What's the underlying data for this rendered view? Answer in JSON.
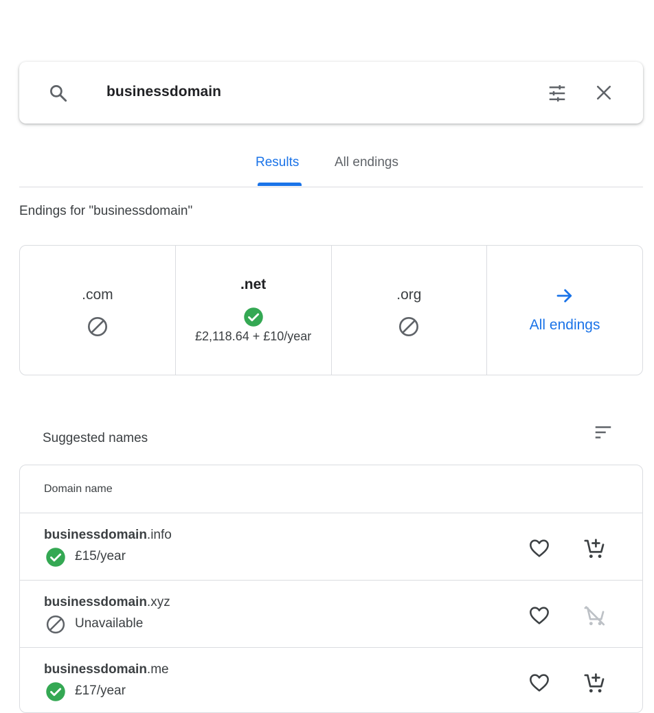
{
  "search": {
    "query": "businessdomain"
  },
  "tabs": [
    {
      "label": "Results",
      "active": true
    },
    {
      "label": "All endings",
      "active": false
    }
  ],
  "endings": {
    "heading": "Endings for \"businessdomain\"",
    "items": [
      {
        "name": ".com",
        "status": "unavailable"
      },
      {
        "name": ".net",
        "status": "available",
        "price": "£2,118.64 + £10/year"
      },
      {
        "name": ".org",
        "status": "unavailable"
      }
    ],
    "all_label": "All endings"
  },
  "suggested": {
    "heading": "Suggested names",
    "column_header": "Domain name",
    "rows": [
      {
        "name": "businessdomain",
        "tld": ".info",
        "status": "available",
        "status_text": "£15/year"
      },
      {
        "name": "businessdomain",
        "tld": ".xyz",
        "status": "unavailable",
        "status_text": "Unavailable"
      },
      {
        "name": "businessdomain",
        "tld": ".me",
        "status": "available",
        "status_text": "£17/year"
      }
    ]
  },
  "colors": {
    "accent": "#1a73e8",
    "available": "#34a853",
    "icon": "#5f6368",
    "disabled": "#bdc1c6"
  }
}
